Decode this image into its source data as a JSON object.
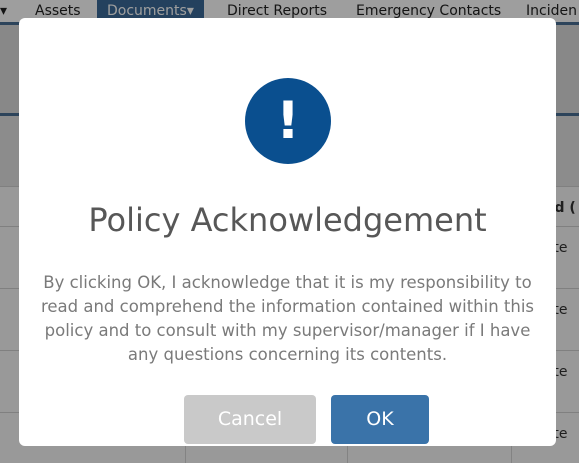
{
  "nav": {
    "caret": "▾",
    "items": [
      {
        "label": "Assets"
      },
      {
        "label": "Documents"
      },
      {
        "label": "Direct Reports"
      },
      {
        "label": "Emergency Contacts"
      },
      {
        "label": "Inciden"
      }
    ],
    "active_caret": "▾"
  },
  "background_table": {
    "header_fragment": "ed (",
    "row_fragments": [
      "l te",
      "l te",
      "l te",
      "l te"
    ]
  },
  "modal": {
    "icon": "exclamation-icon",
    "icon_glyph": "!",
    "title": "Policy Acknowledgement",
    "message": "By clicking OK, I acknowledge that it is my responsibility to read and comprehend the information contained within this policy and to consult with my supervisor/manager if I have any questions concerning its contents.",
    "cancel_label": "Cancel",
    "ok_label": "OK"
  },
  "colors": {
    "brand_blue": "#0a4f8f",
    "ok_button": "#3a73a9",
    "cancel_button": "#c9c9c9",
    "nav_active": "#3a6a98"
  }
}
